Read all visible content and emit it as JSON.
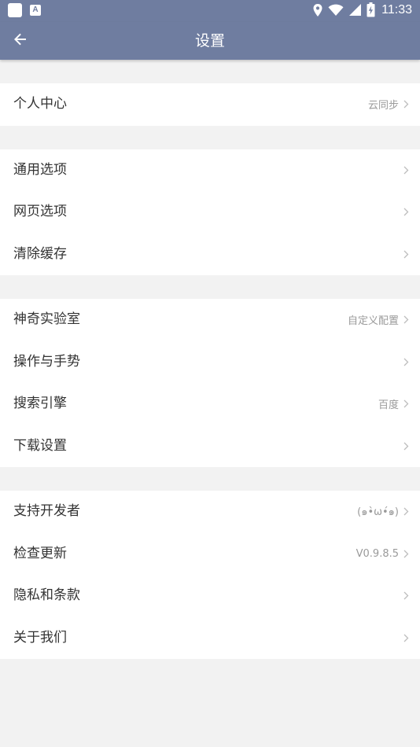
{
  "status_bar": {
    "time": "11:33",
    "icons": [
      "app-square-icon",
      "a-badge-icon",
      "location-icon",
      "wifi-icon",
      "signal-icon",
      "battery-charging-icon"
    ]
  },
  "app_bar": {
    "title": "设置",
    "back_icon": "arrow-left-icon"
  },
  "groups": [
    {
      "items": [
        {
          "label": "个人中心",
          "value": "云同步"
        }
      ]
    },
    {
      "items": [
        {
          "label": "通用选项",
          "value": ""
        },
        {
          "label": "网页选项",
          "value": ""
        },
        {
          "label": "清除缓存",
          "value": ""
        }
      ]
    },
    {
      "items": [
        {
          "label": "神奇实验室",
          "value": "自定义配置"
        },
        {
          "label": "操作与手势",
          "value": ""
        },
        {
          "label": "搜索引擎",
          "value": "百度"
        },
        {
          "label": "下载设置",
          "value": ""
        }
      ]
    },
    {
      "items": [
        {
          "label": "支持开发者",
          "value": "(๑•̀ω•́๑)"
        },
        {
          "label": "检查更新",
          "value": "V0.9.8.5"
        },
        {
          "label": "隐私和条款",
          "value": ""
        },
        {
          "label": "关于我们",
          "value": ""
        }
      ]
    }
  ],
  "colors": {
    "app_bar": "#6f7da0",
    "background": "#f2f2f2",
    "row_background": "#ffffff",
    "label_text": "#333333",
    "value_text": "#9a9a9a"
  }
}
